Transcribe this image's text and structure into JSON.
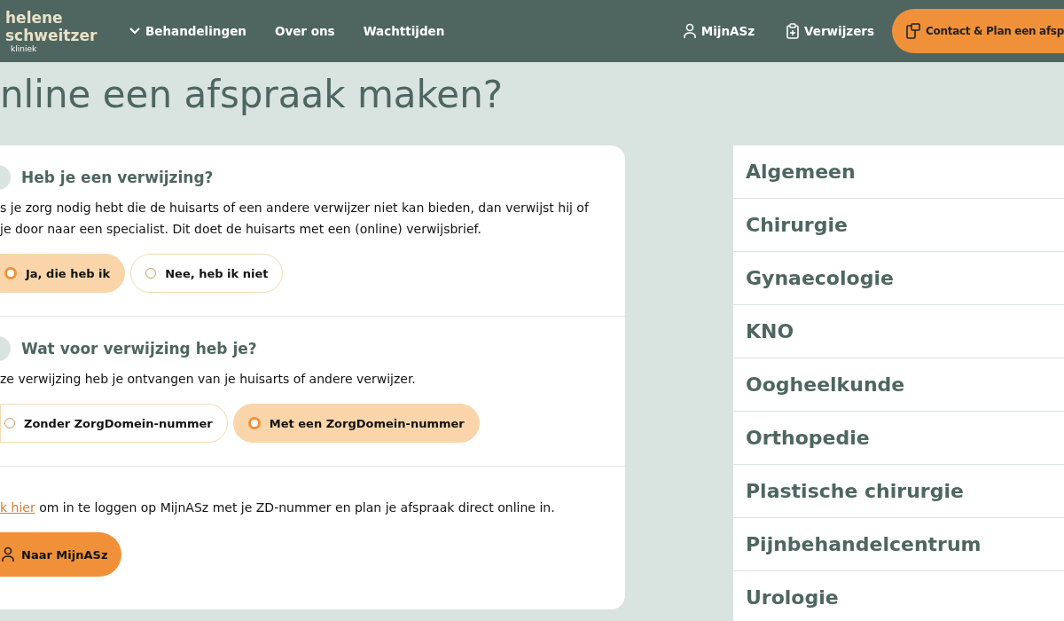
{
  "header": {
    "logo": {
      "line_1": "helene",
      "line_2": "schweitzer",
      "sub": "kliniek"
    },
    "nav": [
      {
        "label": "Behandelingen",
        "dropdown": true
      },
      {
        "label": "Over ons",
        "dropdown": false
      },
      {
        "label": "Wachttijden",
        "dropdown": false
      }
    ],
    "right_links": [
      {
        "label": "MijnASz",
        "kind": "user"
      },
      {
        "label": "Verwijzers",
        "kind": "clipboard"
      }
    ],
    "cta": "Contact & Plan een afsp"
  },
  "title": "nline een afspraak maken?",
  "steps": [
    {
      "heading": "Heb je een verwijzing?",
      "lines": [
        "s je zorg nodig hebt die de huisarts of een andere verwijzer niet kan bieden, dan verwijst hij of",
        "je door naar een specialist. Dit doet de huisarts met een (online) verwijsbrief."
      ],
      "options": [
        {
          "label": "Ja, die heb ik",
          "selected": true
        },
        {
          "label": "Nee, heb ik niet",
          "selected": false
        }
      ]
    },
    {
      "heading": "Wat voor verwijzing heb je?",
      "lines": [
        "ze verwijzing heb je ontvangen van je huisarts of andere verwijzer."
      ],
      "options": [
        {
          "label": "Zonder ZorgDomein-nummer",
          "selected": false
        },
        {
          "label": "Met een ZorgDomein-nummer",
          "selected": true
        }
      ]
    }
  ],
  "result": {
    "link": "k hier",
    "text": " om in te loggen op MijnASz met je ZD-nummer en plan je afspraak direct online in.",
    "button": "Naar MijnASz"
  },
  "specialisms": [
    "Algemeen",
    "Chirurgie",
    "Gynaecologie",
    "KNO",
    "Oogheelkunde",
    "Orthopedie",
    "Plastische chirurgie",
    "Pijnbehandelcentrum",
    "Urologie"
  ]
}
